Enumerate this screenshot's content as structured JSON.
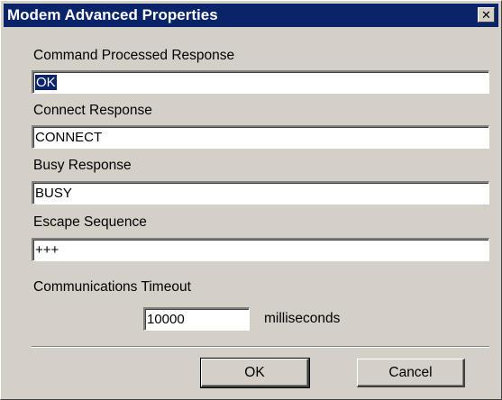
{
  "window": {
    "title": "Modem Advanced Properties",
    "close_glyph": "✕"
  },
  "fields": {
    "command_processed": {
      "label": "Command Processed Response",
      "value": "OK"
    },
    "connect": {
      "label": "Connect Response",
      "value": "CONNECT"
    },
    "busy": {
      "label": "Busy Response",
      "value": "BUSY"
    },
    "escape": {
      "label": "Escape Sequence",
      "value": "+++"
    }
  },
  "timeout": {
    "label": "Communications Timeout",
    "value": "10000",
    "unit": "milliseconds"
  },
  "buttons": {
    "ok": "OK",
    "cancel": "Cancel"
  },
  "colors": {
    "titlebar": "#0a246a",
    "face": "#d4d0c8",
    "selection": "#0a246a"
  }
}
